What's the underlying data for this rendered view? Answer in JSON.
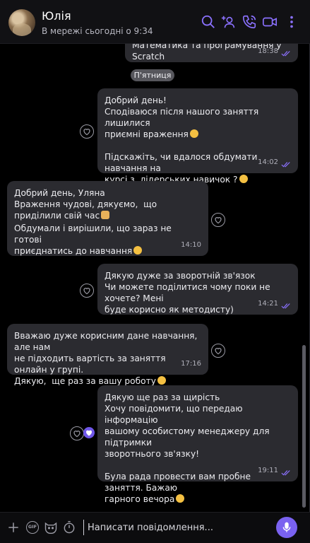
{
  "header": {
    "name": "Юлія",
    "status": "В мережі сьогодні о 9:34",
    "icons": [
      "search-icon",
      "add-participant-icon",
      "call-icon",
      "video-call-icon",
      "more-icon"
    ]
  },
  "chat": {
    "prev_message": {
      "text": "Математика та програмування у Scratch",
      "time": "18:38"
    },
    "day_separator": "П'ятниця",
    "messages": [
      {
        "direction": "out",
        "text": "Добрий день!\nСподіваюся після нашого заняття лишилися\nприємні враження",
        "text2": "Підскажіть, чи вдалося обдумати навчання на\nкурсі з  лідерських навичок ?",
        "time": "14:02"
      },
      {
        "direction": "in",
        "text": "Добрий день, Уляна\nВраження чудові, дякуємо,  що приділили свій час",
        "text2": "Обдумали і вирішили, що зараз не готові\nприєднатись до навчання",
        "time": "14:10"
      },
      {
        "direction": "out",
        "text": "Дякую дуже за зворотній зв'язок\nЧи можете поділитися чому поки не хочете? Мені\nбуде корисно як методисту)",
        "time": "14:21"
      },
      {
        "direction": "in",
        "text": "Вважаю дуже корисним дане навчання, але нам\nне підходить вартість за заняття онлайн у групі.\nДякую,  ще раз за вашу роботу",
        "time": "17:16"
      },
      {
        "direction": "out",
        "text": "Дякую ще раз за щирість\nХочу повідомити, що передаю інформацію\nвашому особистому менеджеру для підтримки\nзворотнього зв'язку!",
        "text2": "Була рада провести вам пробне заняття. Бажаю\nгарного вечора",
        "time": "19:11"
      }
    ]
  },
  "composer": {
    "placeholder": "Написати повідомлення...",
    "gif_label": "GIF",
    "icons": [
      "plus-icon",
      "gif-icon",
      "sticker-icon",
      "timer-icon",
      "microphone-icon"
    ]
  },
  "colors": {
    "accent": "#8b71ff",
    "bubble": "#2b2b30",
    "background": "#000000"
  }
}
